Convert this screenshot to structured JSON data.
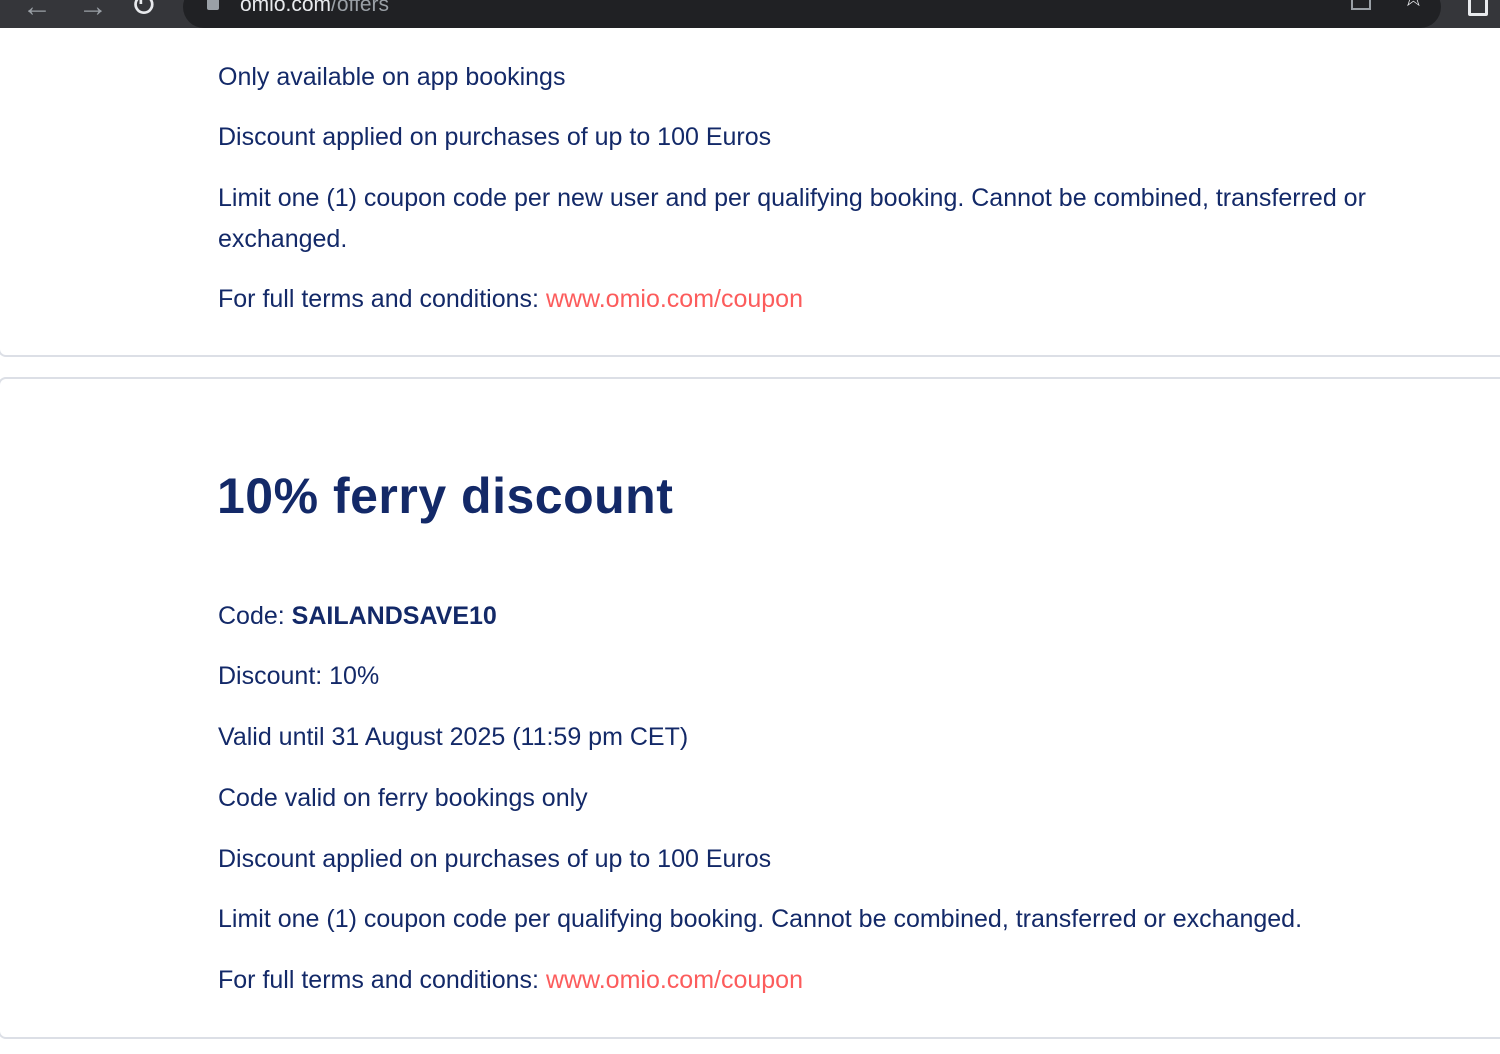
{
  "browser": {
    "url_host": "omio.com",
    "url_path": "/offers"
  },
  "coupon_prev": {
    "lines": [
      "Only available on app bookings",
      "Discount applied on purchases of up to 100 Euros",
      "Limit one (1) coupon code per new user and per qualifying booking. Cannot be combined, transferred or exchanged."
    ],
    "terms_label": "For full terms and conditions:",
    "terms_link": "www.omio.com/coupon"
  },
  "coupon_ferry": {
    "title": "10% ferry discount",
    "code_label": "Code:",
    "code_value": "SAILANDSAVE10",
    "discount": "Discount: 10%",
    "validity": "Valid until 31 August 2025 (11:59 pm CET)",
    "scope": "Code valid on ferry bookings only",
    "cap": "Discount applied on purchases of up to 100 Euros",
    "limit": "Limit one (1) coupon code per qualifying booking. Cannot be combined, transferred or exchanged.",
    "terms_label": "For full terms and conditions:",
    "terms_link": "www.omio.com/coupon"
  }
}
